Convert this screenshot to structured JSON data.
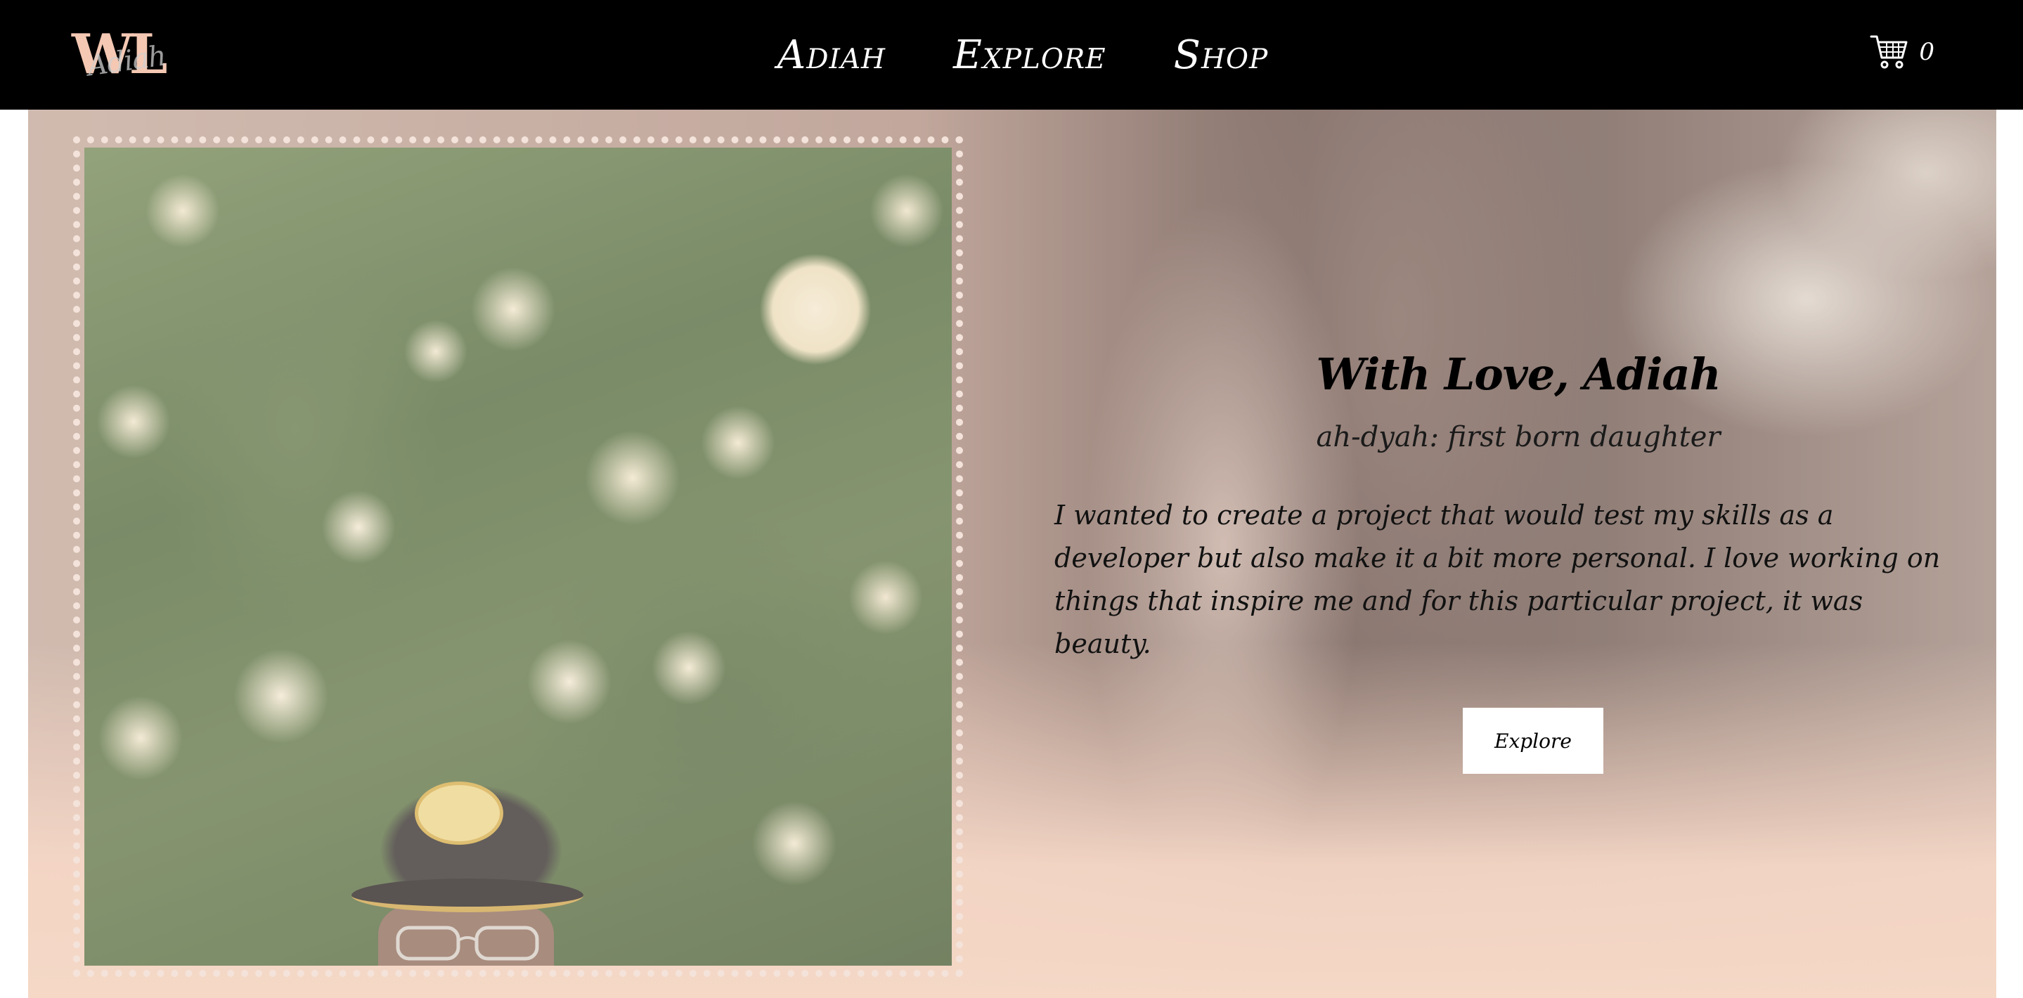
{
  "header": {
    "logo": {
      "monogram": "WL",
      "script": "Adiah"
    },
    "nav": [
      {
        "label": "Adiah"
      },
      {
        "label": "Explore"
      },
      {
        "label": "Shop"
      }
    ],
    "cart": {
      "icon": "shopping-cart-icon",
      "count": "0"
    }
  },
  "hero": {
    "title": "With Love, Adiah",
    "subtitle": "ah-dyah: first born daughter",
    "body": "I wanted to create a project that would test my skills as a developer but also make it a bit more personal. I love working on things that inspire me and for this particular project, it was beauty.",
    "button_label": "Explore"
  },
  "colors": {
    "header_bg": "#000000",
    "logo_accent": "#f4c8b3",
    "hero_fade": "#f6d7c4",
    "frame_dots": "#f4e3da"
  }
}
